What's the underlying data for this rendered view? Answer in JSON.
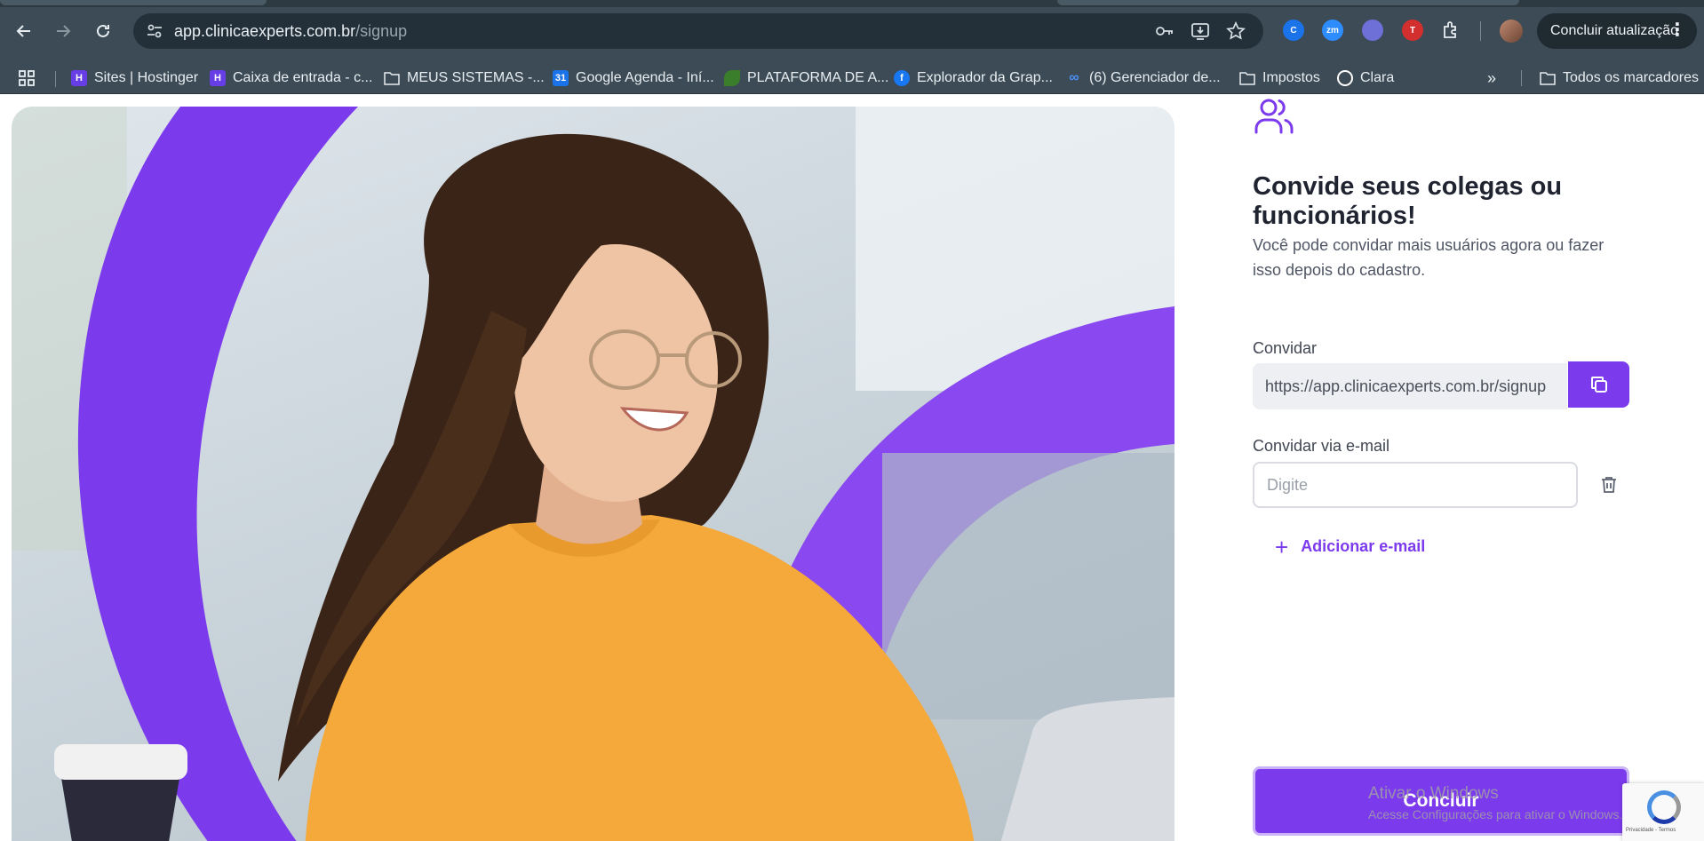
{
  "browser": {
    "url_host": "app.clinicaexperts.com.br",
    "url_path": "/signup",
    "update_button_label": "Concluir atualização",
    "kebab_label": "⋮",
    "bookmarks": [
      {
        "label": "Sites | Hostinger"
      },
      {
        "label": "Caixa de entrada - c..."
      },
      {
        "label": "MEUS SISTEMAS -..."
      },
      {
        "label": "Google Agenda - Iní..."
      },
      {
        "label": "PLATAFORMA DE A..."
      },
      {
        "label": "Explorador da Grap..."
      },
      {
        "label": "(6) Gerenciador de..."
      },
      {
        "label": "Impostos"
      },
      {
        "label": "Clara"
      }
    ],
    "overflow_label": "»",
    "all_bookmarks_label": "Todos os marcadores",
    "extensions": [
      {
        "name": "extension-c",
        "label": "C",
        "color": "#1a73e8"
      },
      {
        "name": "extension-zoom",
        "label": "zm",
        "color": "#2d8cff"
      },
      {
        "name": "extension-glasses",
        "label": "",
        "color": "#6f6fd8"
      },
      {
        "name": "extension-t",
        "label": "T",
        "color": "#d32f2f"
      }
    ]
  },
  "invite": {
    "title": "Convide seus colegas ou funcionários!",
    "subtitle": "Você pode convidar mais usuários agora ou fazer isso depois do cadastro.",
    "link_label": "Convidar",
    "link_value": "https://app.clinicaexperts.com.br/signup",
    "email_label": "Convidar via e-mail",
    "email_placeholder": "Digite",
    "add_email_label": "Adicionar e-mail",
    "submit_label": "Concluir"
  },
  "overlay": {
    "watermark_title": "Ativar o Windows",
    "watermark_text": "Acesse Configurações para ativar o Windows.",
    "recaptcha_text": "Privacidade - Termos"
  },
  "colors": {
    "brand": "#7c3aed",
    "browser_frame": "#3c4b55",
    "text_dark": "#1f2430"
  }
}
